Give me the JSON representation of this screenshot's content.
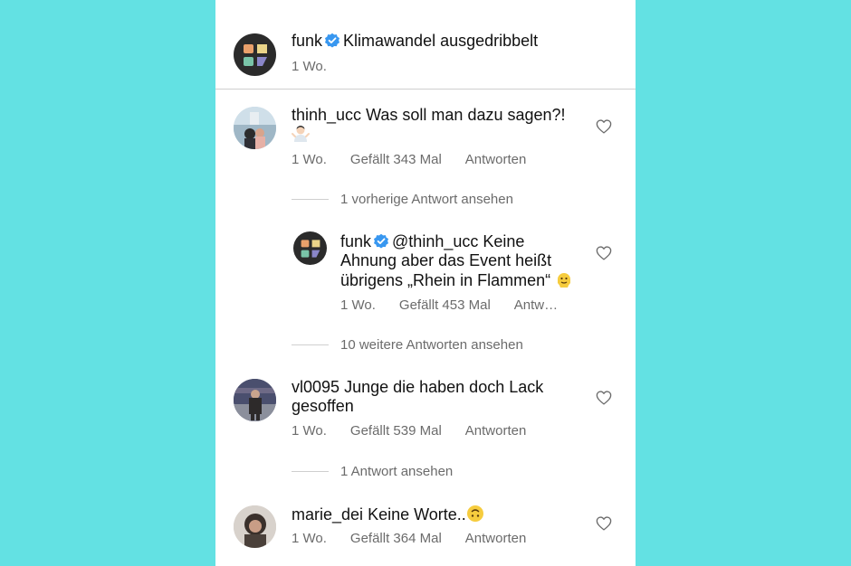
{
  "post": {
    "username": "funk",
    "caption": "Klimawandel ausgedribbelt",
    "age": "1 Wo."
  },
  "comments": [
    {
      "username": "thinh_ucc",
      "text": "Was soll man dazu sagen?!",
      "emoji": "shrug",
      "age": "1 Wo.",
      "likes": "Gefällt 343 Mal",
      "reply": "Antworten",
      "view_replies": "1 vorherige Antwort ansehen"
    },
    {
      "username": "funk",
      "mention": "@thinh_ucc",
      "text_line1": "Keine",
      "text_line2": "Ahnung aber das Event heißt",
      "text_line3": "übrigens „Rhein in Flammen“",
      "emoji": "melting-face",
      "age": "1 Wo.",
      "likes": "Gefällt 453 Mal",
      "reply": "Antw…",
      "view_replies": "10 weitere Antworten ansehen"
    },
    {
      "username": "vl0095",
      "text_line1": "Junge die haben doch Lack",
      "text_line2": "gesoffen",
      "age": "1 Wo.",
      "likes": "Gefällt 539 Mal",
      "reply": "Antworten",
      "view_replies": "1 Antwort ansehen"
    },
    {
      "username": "marie_dei",
      "text": "Keine Worte..",
      "emoji": "upside-down-face",
      "age": "1 Wo.",
      "likes": "Gefällt 364 Mal",
      "reply": "Antworten"
    }
  ],
  "colors": {
    "background": "#63e1e3",
    "verified": "#3897f0",
    "text": "#111111",
    "meta": "#6b6b6b"
  }
}
